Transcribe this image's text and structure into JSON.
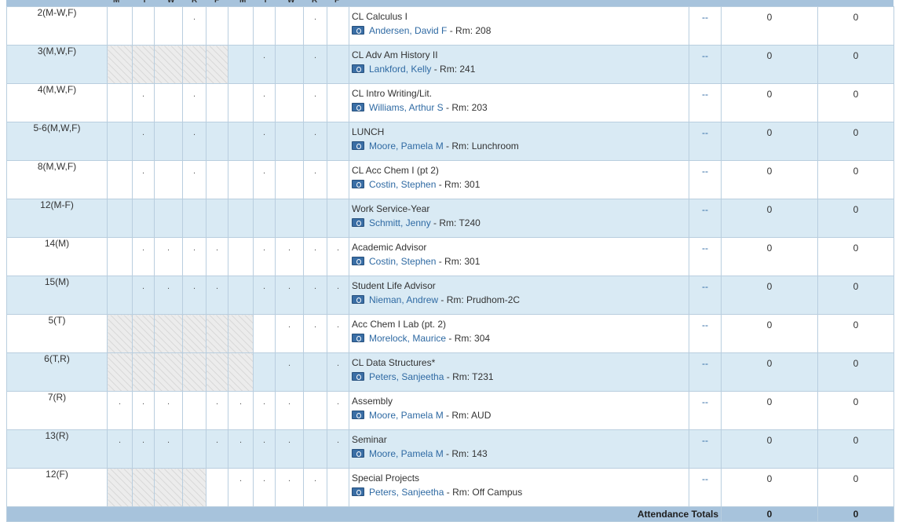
{
  "header_days": [
    "M",
    "T",
    "W",
    "R",
    "F",
    "M",
    "T",
    "W",
    "R",
    "F"
  ],
  "rows": [
    {
      "period": "2(M-W,F)",
      "course": "CL Calculus I",
      "teacher": "Andersen, David F",
      "room": " - Rm: 208",
      "dash": "--",
      "absences": "0",
      "tardies": "0",
      "days": [
        {
          "h": false,
          "d": ""
        },
        {
          "h": false,
          "d": ""
        },
        {
          "h": false,
          "d": ""
        },
        {
          "h": false,
          "d": "."
        },
        {
          "h": false,
          "d": ""
        },
        {
          "h": false,
          "d": ""
        },
        {
          "h": false,
          "d": ""
        },
        {
          "h": false,
          "d": ""
        },
        {
          "h": false,
          "d": "."
        },
        {
          "h": false,
          "d": ""
        }
      ]
    },
    {
      "period": "3(M,W,F)",
      "course": "CL Adv Am History II",
      "teacher": "Lankford, Kelly",
      "room": " - Rm: 241",
      "dash": "--",
      "absences": "0",
      "tardies": "0",
      "days": [
        {
          "h": true,
          "d": ""
        },
        {
          "h": true,
          "d": ""
        },
        {
          "h": true,
          "d": ""
        },
        {
          "h": true,
          "d": ""
        },
        {
          "h": true,
          "d": ""
        },
        {
          "h": false,
          "d": ""
        },
        {
          "h": false,
          "d": "."
        },
        {
          "h": false,
          "d": ""
        },
        {
          "h": false,
          "d": "."
        },
        {
          "h": false,
          "d": ""
        }
      ]
    },
    {
      "period": "4(M,W,F)",
      "course": "CL Intro Writing/Lit.",
      "teacher": "Williams, Arthur S",
      "room": " - Rm: 203",
      "dash": "--",
      "absences": "0",
      "tardies": "0",
      "days": [
        {
          "h": false,
          "d": ""
        },
        {
          "h": false,
          "d": "."
        },
        {
          "h": false,
          "d": ""
        },
        {
          "h": false,
          "d": "."
        },
        {
          "h": false,
          "d": ""
        },
        {
          "h": false,
          "d": ""
        },
        {
          "h": false,
          "d": "."
        },
        {
          "h": false,
          "d": ""
        },
        {
          "h": false,
          "d": "."
        },
        {
          "h": false,
          "d": ""
        }
      ]
    },
    {
      "period": "5-6(M,W,F)",
      "course": "LUNCH",
      "teacher": "Moore, Pamela M",
      "room": " - Rm: Lunchroom",
      "dash": "--",
      "absences": "0",
      "tardies": "0",
      "days": [
        {
          "h": false,
          "d": ""
        },
        {
          "h": false,
          "d": "."
        },
        {
          "h": false,
          "d": ""
        },
        {
          "h": false,
          "d": "."
        },
        {
          "h": false,
          "d": ""
        },
        {
          "h": false,
          "d": ""
        },
        {
          "h": false,
          "d": "."
        },
        {
          "h": false,
          "d": ""
        },
        {
          "h": false,
          "d": "."
        },
        {
          "h": false,
          "d": ""
        }
      ]
    },
    {
      "period": "8(M,W,F)",
      "course": "CL Acc Chem I (pt 2)",
      "teacher": "Costin, Stephen",
      "room": " - Rm: 301",
      "dash": "--",
      "absences": "0",
      "tardies": "0",
      "days": [
        {
          "h": false,
          "d": ""
        },
        {
          "h": false,
          "d": "."
        },
        {
          "h": false,
          "d": ""
        },
        {
          "h": false,
          "d": "."
        },
        {
          "h": false,
          "d": ""
        },
        {
          "h": false,
          "d": ""
        },
        {
          "h": false,
          "d": "."
        },
        {
          "h": false,
          "d": ""
        },
        {
          "h": false,
          "d": "."
        },
        {
          "h": false,
          "d": ""
        }
      ]
    },
    {
      "period": "12(M-F)",
      "course": "Work Service-Year",
      "teacher": "Schmitt, Jenny",
      "room": " - Rm: T240",
      "dash": "--",
      "absences": "0",
      "tardies": "0",
      "days": [
        {
          "h": false,
          "d": ""
        },
        {
          "h": false,
          "d": ""
        },
        {
          "h": false,
          "d": ""
        },
        {
          "h": false,
          "d": ""
        },
        {
          "h": false,
          "d": ""
        },
        {
          "h": false,
          "d": ""
        },
        {
          "h": false,
          "d": ""
        },
        {
          "h": false,
          "d": ""
        },
        {
          "h": false,
          "d": ""
        },
        {
          "h": false,
          "d": ""
        }
      ]
    },
    {
      "period": "14(M)",
      "course": "Academic Advisor",
      "teacher": "Costin, Stephen",
      "room": " - Rm: 301",
      "dash": "--",
      "absences": "0",
      "tardies": "0",
      "days": [
        {
          "h": false,
          "d": ""
        },
        {
          "h": false,
          "d": "."
        },
        {
          "h": false,
          "d": "."
        },
        {
          "h": false,
          "d": "."
        },
        {
          "h": false,
          "d": "."
        },
        {
          "h": false,
          "d": ""
        },
        {
          "h": false,
          "d": "."
        },
        {
          "h": false,
          "d": "."
        },
        {
          "h": false,
          "d": "."
        },
        {
          "h": false,
          "d": "."
        }
      ]
    },
    {
      "period": "15(M)",
      "course": "Student Life Advisor",
      "teacher": "Nieman, Andrew",
      "room": " - Rm: Prudhom-2C",
      "dash": "--",
      "absences": "0",
      "tardies": "0",
      "days": [
        {
          "h": false,
          "d": ""
        },
        {
          "h": false,
          "d": "."
        },
        {
          "h": false,
          "d": "."
        },
        {
          "h": false,
          "d": "."
        },
        {
          "h": false,
          "d": "."
        },
        {
          "h": false,
          "d": ""
        },
        {
          "h": false,
          "d": "."
        },
        {
          "h": false,
          "d": "."
        },
        {
          "h": false,
          "d": "."
        },
        {
          "h": false,
          "d": "."
        }
      ]
    },
    {
      "period": "5(T)",
      "course": "Acc Chem I Lab (pt. 2)",
      "teacher": "Morelock, Maurice",
      "room": " - Rm: 304",
      "dash": "--",
      "absences": "0",
      "tardies": "0",
      "days": [
        {
          "h": true,
          "d": ""
        },
        {
          "h": true,
          "d": ""
        },
        {
          "h": true,
          "d": ""
        },
        {
          "h": true,
          "d": ""
        },
        {
          "h": true,
          "d": ""
        },
        {
          "h": true,
          "d": ""
        },
        {
          "h": false,
          "d": ""
        },
        {
          "h": false,
          "d": "."
        },
        {
          "h": false,
          "d": "."
        },
        {
          "h": false,
          "d": "."
        }
      ]
    },
    {
      "period": "6(T,R)",
      "course": "CL Data Structures*",
      "teacher": "Peters, Sanjeetha",
      "room": " - Rm: T231",
      "dash": "--",
      "absences": "0",
      "tardies": "0",
      "days": [
        {
          "h": true,
          "d": ""
        },
        {
          "h": true,
          "d": ""
        },
        {
          "h": true,
          "d": ""
        },
        {
          "h": true,
          "d": ""
        },
        {
          "h": true,
          "d": ""
        },
        {
          "h": true,
          "d": ""
        },
        {
          "h": false,
          "d": ""
        },
        {
          "h": false,
          "d": "."
        },
        {
          "h": false,
          "d": ""
        },
        {
          "h": false,
          "d": "."
        }
      ]
    },
    {
      "period": "7(R)",
      "course": "Assembly",
      "teacher": "Moore, Pamela M",
      "room": " - Rm: AUD",
      "dash": "--",
      "absences": "0",
      "tardies": "0",
      "days": [
        {
          "h": false,
          "d": "."
        },
        {
          "h": false,
          "d": "."
        },
        {
          "h": false,
          "d": "."
        },
        {
          "h": false,
          "d": ""
        },
        {
          "h": false,
          "d": "."
        },
        {
          "h": false,
          "d": "."
        },
        {
          "h": false,
          "d": "."
        },
        {
          "h": false,
          "d": "."
        },
        {
          "h": false,
          "d": ""
        },
        {
          "h": false,
          "d": "."
        }
      ]
    },
    {
      "period": "13(R)",
      "course": "Seminar",
      "teacher": "Moore, Pamela M",
      "room": " - Rm: 143",
      "dash": "--",
      "absences": "0",
      "tardies": "0",
      "days": [
        {
          "h": false,
          "d": "."
        },
        {
          "h": false,
          "d": "."
        },
        {
          "h": false,
          "d": "."
        },
        {
          "h": false,
          "d": ""
        },
        {
          "h": false,
          "d": "."
        },
        {
          "h": false,
          "d": "."
        },
        {
          "h": false,
          "d": "."
        },
        {
          "h": false,
          "d": "."
        },
        {
          "h": false,
          "d": ""
        },
        {
          "h": false,
          "d": "."
        }
      ]
    },
    {
      "period": "12(F)",
      "course": "Special Projects",
      "teacher": "Peters, Sanjeetha",
      "room": " - Rm: Off Campus",
      "dash": "--",
      "absences": "0",
      "tardies": "0",
      "days": [
        {
          "h": true,
          "d": ""
        },
        {
          "h": true,
          "d": ""
        },
        {
          "h": true,
          "d": ""
        },
        {
          "h": true,
          "d": ""
        },
        {
          "h": false,
          "d": ""
        },
        {
          "h": false,
          "d": "."
        },
        {
          "h": false,
          "d": "."
        },
        {
          "h": false,
          "d": "."
        },
        {
          "h": false,
          "d": "."
        },
        {
          "h": false,
          "d": ""
        }
      ]
    }
  ],
  "totals": {
    "label": "Attendance Totals",
    "absences": "0",
    "tardies": "0"
  },
  "colors": {
    "header": "#a7c3dc",
    "row_alt": "#d9eaf4",
    "link": "#2f6aa3",
    "teacher_icon": "#3a6ea5"
  }
}
